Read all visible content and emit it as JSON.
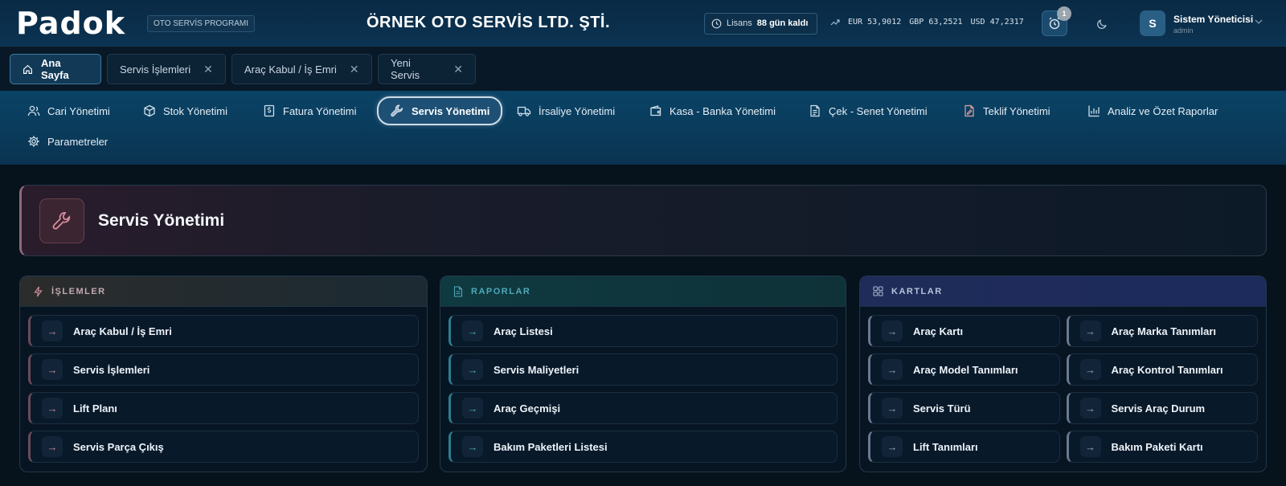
{
  "header": {
    "logo": "Padok",
    "program_badge": "OTO SERVİS PROGRAMI",
    "company": "ÖRNEK OTO SERVİS LTD. ŞTİ.",
    "license_label": "Lisans",
    "license_days": "88 gün kaldı",
    "rates": [
      {
        "code": "EUR",
        "value": "53,9012"
      },
      {
        "code": "GBP",
        "value": "63,2521"
      },
      {
        "code": "USD",
        "value": "47,2317"
      }
    ],
    "notification_count": "1",
    "user": {
      "initial": "S",
      "name": "Sistem Yöneticisi",
      "role": "admin"
    }
  },
  "tabs": [
    {
      "label": "Ana Sayfa",
      "active": true
    },
    {
      "label": "Servis İşlemleri"
    },
    {
      "label": "Araç Kabul / İş Emri"
    },
    {
      "label": "Yeni Servis"
    }
  ],
  "modules": [
    {
      "label": "Cari Yönetimi",
      "icon": "users-icon"
    },
    {
      "label": "Stok Yönetimi",
      "icon": "box-icon"
    },
    {
      "label": "Fatura Yönetimi",
      "icon": "invoice-icon"
    },
    {
      "label": "Servis Yönetimi",
      "icon": "wrench-icon",
      "active": true
    },
    {
      "label": "İrsaliye Yönetimi",
      "icon": "truck-icon"
    },
    {
      "label": "Kasa - Banka Yönetimi",
      "icon": "wallet-icon"
    },
    {
      "label": "Çek - Senet Yönetimi",
      "icon": "document-icon"
    },
    {
      "label": "Teklif Yönetimi",
      "icon": "quote-icon"
    },
    {
      "label": "Analiz ve Özet Raporlar",
      "icon": "chart-icon"
    },
    {
      "label": "Parametreler",
      "icon": "gear-icon"
    }
  ],
  "page": {
    "title": "Servis Yönetimi",
    "icon": "wrench-icon"
  },
  "cards": {
    "islemler": {
      "title": "İŞLEMLER",
      "items": [
        "Araç Kabul / İş Emri",
        "Servis İşlemleri",
        "Lift Planı",
        "Servis Parça Çıkış"
      ]
    },
    "raporlar": {
      "title": "RAPORLAR",
      "items": [
        "Araç Listesi",
        "Servis Maliyetleri",
        "Araç Geçmişi",
        "Bakım Paketleri Listesi"
      ]
    },
    "kartlar": {
      "title": "KARTLAR",
      "items": [
        "Araç Kartı",
        "Araç Marka Tanımları",
        "Araç Model Tanımları",
        "Araç Kontrol Tanımları",
        "Servis Türü",
        "Servis Araç Durum",
        "Lift Tanımları",
        "Bakım Paketi Kartı"
      ]
    }
  },
  "colors": {
    "accent": "#1e5075",
    "islemler": "#c4a8b0",
    "raporlar": "#4fa8b9",
    "kartlar": "#b7c2d8"
  }
}
